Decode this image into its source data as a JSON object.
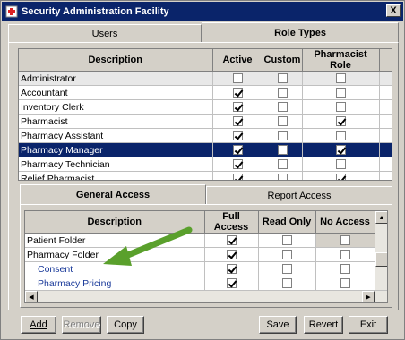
{
  "window": {
    "title": "Security Administration Facility",
    "close": "X"
  },
  "top_tabs": [
    {
      "label": "Users"
    },
    {
      "label": "Role Types"
    }
  ],
  "roles": {
    "headers": [
      "Description",
      "Active",
      "Custom",
      "Pharmacist Role"
    ],
    "rows": [
      {
        "desc": "Administrator",
        "active": false,
        "custom": false,
        "pharm": false
      },
      {
        "desc": "Accountant",
        "active": true,
        "custom": false,
        "pharm": false
      },
      {
        "desc": "Inventory Clerk",
        "active": true,
        "custom": false,
        "pharm": false
      },
      {
        "desc": "Pharmacist",
        "active": true,
        "custom": false,
        "pharm": true
      },
      {
        "desc": "Pharmacy Assistant",
        "active": true,
        "custom": false,
        "pharm": false
      },
      {
        "desc": "Pharmacy Manager",
        "active": true,
        "custom": false,
        "pharm": true
      },
      {
        "desc": "Pharmacy Technician",
        "active": true,
        "custom": false,
        "pharm": false
      },
      {
        "desc": "Relief Pharmacist",
        "active": true,
        "custom": false,
        "pharm": true
      }
    ]
  },
  "access_tabs": [
    {
      "label": "General Access"
    },
    {
      "label": "Report Access"
    }
  ],
  "access": {
    "headers": [
      "Description",
      "Full Access",
      "Read Only",
      "No Access"
    ],
    "rows": [
      {
        "desc": "Patient Folder",
        "full": true,
        "read": false,
        "none": false
      },
      {
        "desc": "Pharmacy Folder",
        "full": true,
        "read": false,
        "none": false
      },
      {
        "desc": "Consent",
        "full": true,
        "read": false,
        "none": false
      },
      {
        "desc": "Pharmacy Pricing",
        "full": true,
        "read": false,
        "none": false
      }
    ]
  },
  "buttons": {
    "add": "Add",
    "remove": "Remove",
    "copy": "Copy",
    "save": "Save",
    "revert": "Revert",
    "exit": "Exit"
  },
  "colors": {
    "titlebar": "#0a246a",
    "selection": "#0a246a",
    "arrow": "#5aa02c",
    "link": "#1a3a9a"
  }
}
